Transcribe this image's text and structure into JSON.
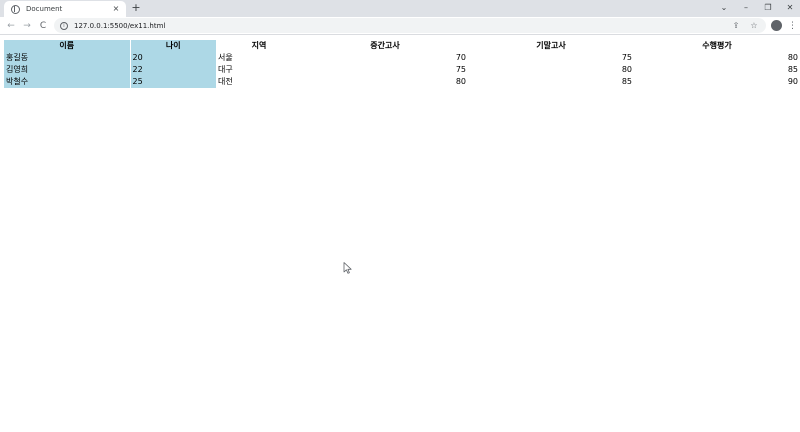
{
  "browser": {
    "tab_title": "Document",
    "tab_close": "×",
    "new_tab": "+",
    "url": "127.0.0.1:5500/ex11.html",
    "window": {
      "dropdown": "⌄",
      "minimize": "–",
      "restore": "❐",
      "close": "✕"
    },
    "nav": {
      "back": "←",
      "forward": "→",
      "reload": "C"
    },
    "info": "i",
    "share": "⇪",
    "bookmark": "☆",
    "menu": "⋮"
  },
  "table": {
    "headers": [
      "이름",
      "나이",
      "지역",
      "중간고사",
      "기말고사",
      "수행평가"
    ],
    "rows": [
      {
        "name": "홍길동",
        "age": "20",
        "region": "서울",
        "mid": "70",
        "final": "75",
        "perf": "80"
      },
      {
        "name": "김영희",
        "age": "22",
        "region": "대구",
        "mid": "75",
        "final": "80",
        "perf": "85"
      },
      {
        "name": "박철수",
        "age": "25",
        "region": "대전",
        "mid": "80",
        "final": "85",
        "perf": "90"
      }
    ]
  },
  "colors": {
    "highlight": "#add8e6",
    "tabstrip": "#dee1e6",
    "omnibox": "#f1f3f4"
  }
}
